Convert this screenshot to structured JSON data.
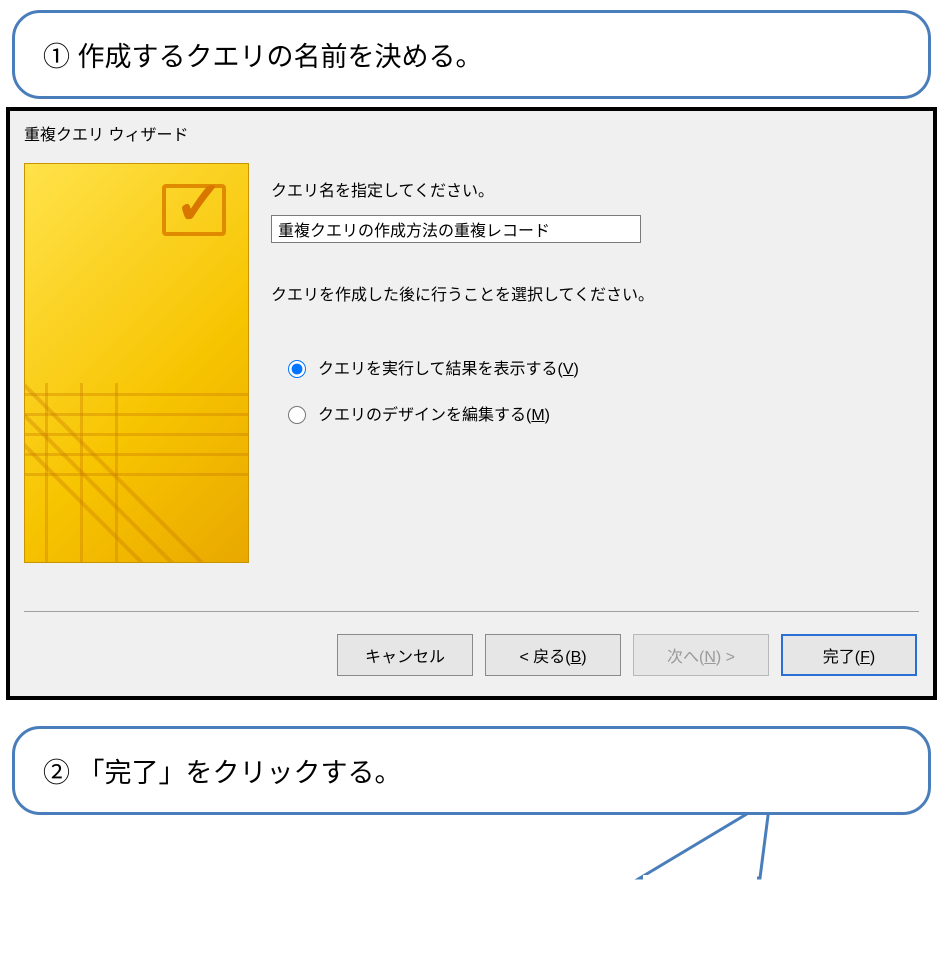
{
  "callouts": {
    "top": "① 作成するクエリの名前を決める。",
    "bottom": "② 「完了」をクリックする。"
  },
  "dialog": {
    "title": "重複クエリ ウィザード",
    "prompt_name": "クエリ名を指定してください。",
    "input_value": "重複クエリの作成方法の重複レコード",
    "prompt_after": "クエリを作成した後に行うことを選択してください。",
    "radio_view_pre": "クエリを実行して結果を表示する(",
    "radio_view_key": "V",
    "radio_view_post": ")",
    "radio_edit_pre": "クエリのデザインを編集する(",
    "radio_edit_key": "M",
    "radio_edit_post": ")",
    "buttons": {
      "cancel": "キャンセル",
      "back_pre": "< 戻る(",
      "back_key": "B",
      "back_post": ")",
      "next_pre": "次へ(",
      "next_key": "N",
      "next_post": ") >",
      "finish_pre": "完了(",
      "finish_key": "F",
      "finish_post": ")"
    }
  }
}
